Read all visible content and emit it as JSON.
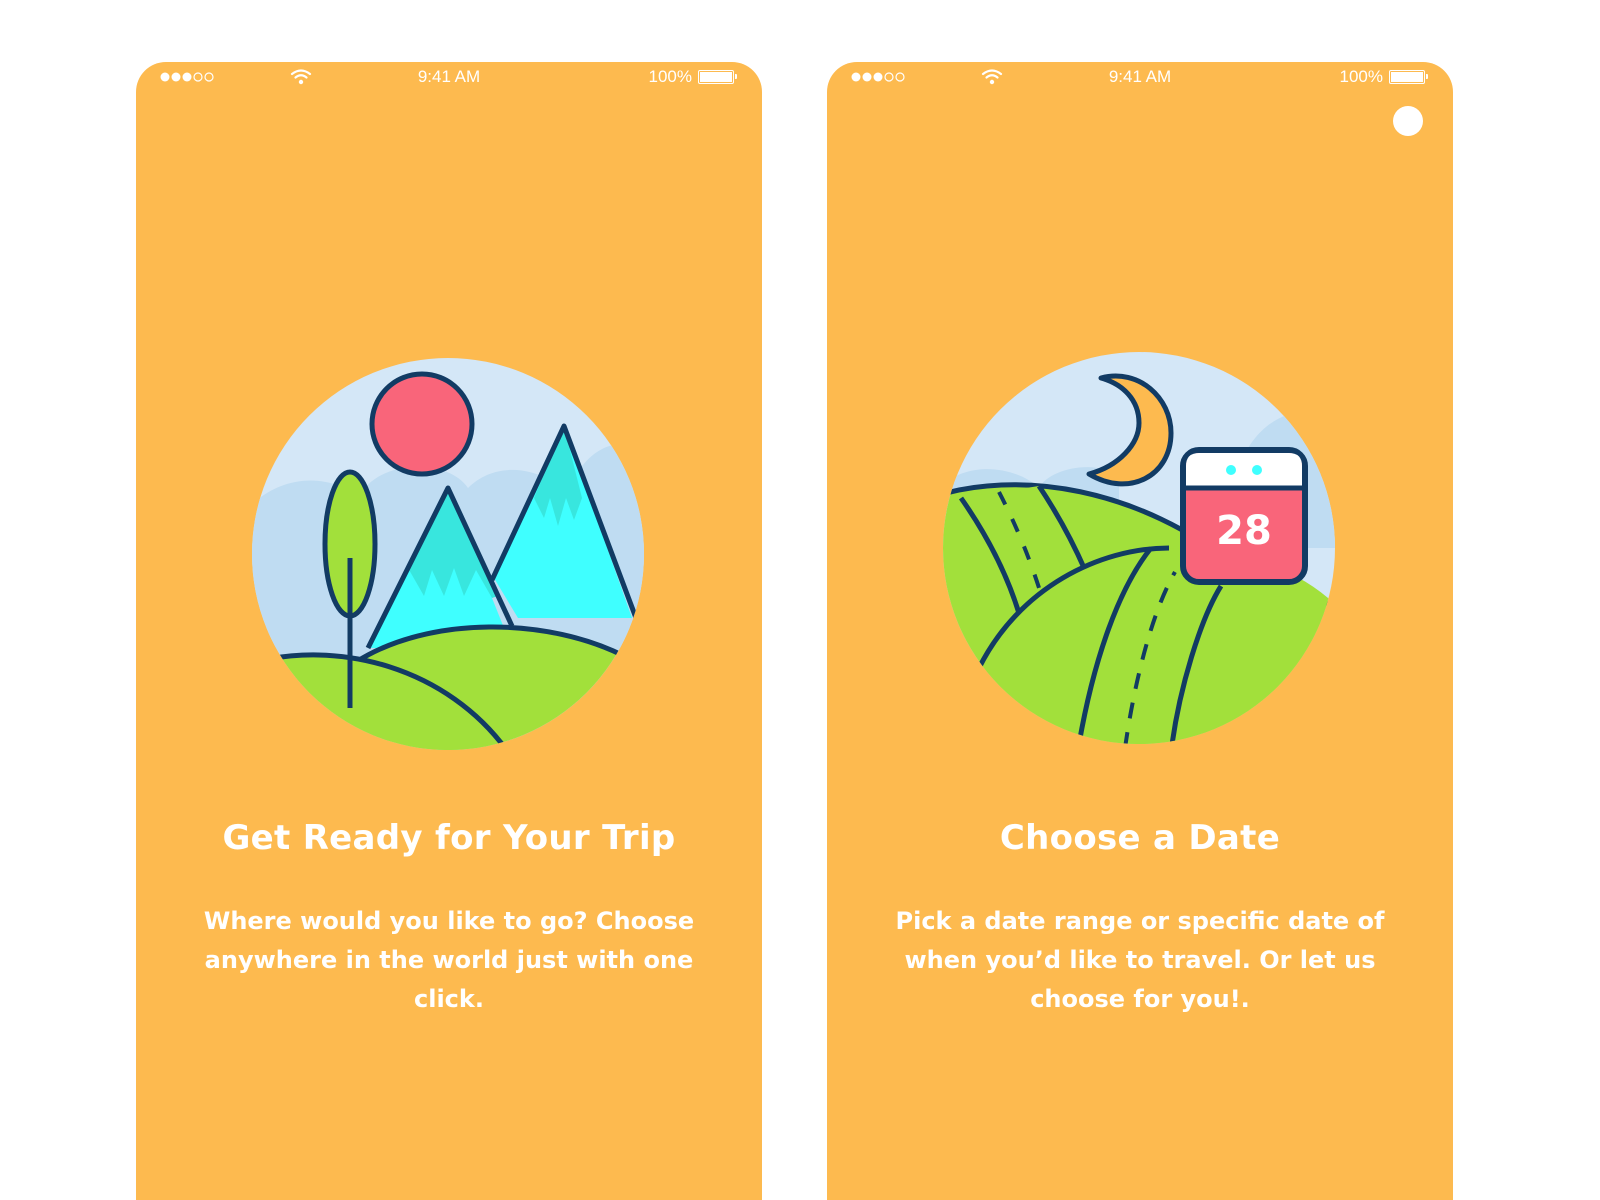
{
  "colors": {
    "background": "#FDBA4F",
    "text": "#FFFFFF",
    "outline": "#123B64",
    "sky": "#D4E7F7",
    "cloud": "#BFDCF2",
    "hill": "#A2E03B",
    "mountain_light": "#38E6DE",
    "mountain_bright": "#3FFFFF",
    "sun": "#F9657A",
    "calendar": "#F9657A"
  },
  "screens": [
    {
      "status_bar": {
        "time": "9:41 AM",
        "battery": "100%"
      },
      "illustration_icon": "mountains-sun-icon",
      "title": "Get Ready for Your Trip",
      "description": "Where would you like to go? Choose anywhere in the world just with one click."
    },
    {
      "status_bar": {
        "time": "9:41 AM",
        "battery": "100%"
      },
      "illustration_icon": "road-moon-calendar-icon",
      "calendar_day": "28",
      "title": "Choose a Date",
      "description": "Pick a date range or specific date of when you’d like to travel. Or let us choose for you!."
    }
  ]
}
